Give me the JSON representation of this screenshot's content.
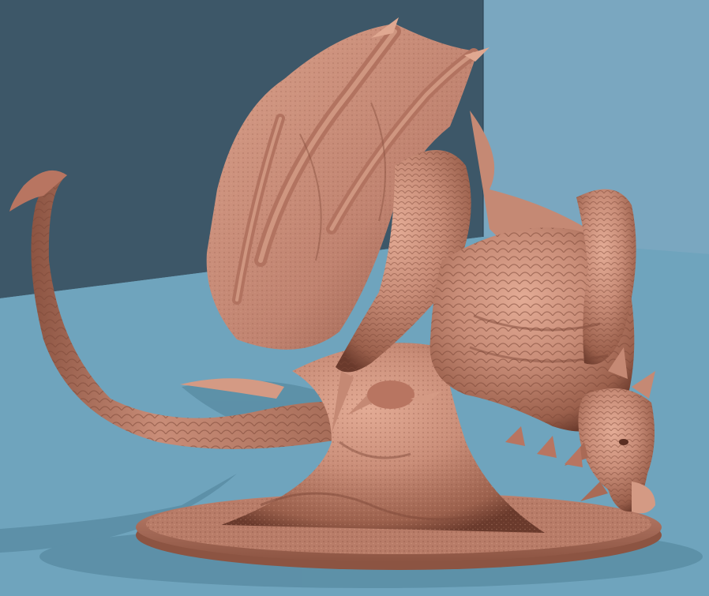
{
  "scene": {
    "subject": "dragon-miniature-render",
    "colors": {
      "back_wall_dark": "#3d5768",
      "back_wall_light": "#7aa7c0",
      "floor": "#6fa4bd",
      "shadow": "#4f8197",
      "model_base": "#c98d78",
      "model_mid": "#b77763",
      "model_shade": "#8c5442",
      "model_deep": "#6a3a2c",
      "model_highlight": "#e3ab95"
    }
  }
}
